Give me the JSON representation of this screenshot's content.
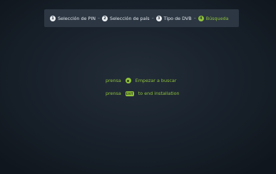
{
  "stepper": {
    "steps": [
      {
        "number": "1",
        "label": "Selección de PIN"
      },
      {
        "number": "2",
        "label": "Selección de país"
      },
      {
        "number": "3",
        "label": "Tipo de DVB"
      },
      {
        "number": "4",
        "label": "Búsqueda"
      }
    ],
    "separator": "–",
    "active_step": 4
  },
  "prompts": [
    {
      "prefix": "prensa",
      "key": "ok-button",
      "text": "Empezar a buscar"
    },
    {
      "prefix": "prensa",
      "key": "exit-button",
      "key_label": "EXIT",
      "text": "to end installation"
    }
  ],
  "colors": {
    "accent": "#8fc23a",
    "stepper_bg": "#2c3743",
    "screen_bg": "#18212b"
  }
}
